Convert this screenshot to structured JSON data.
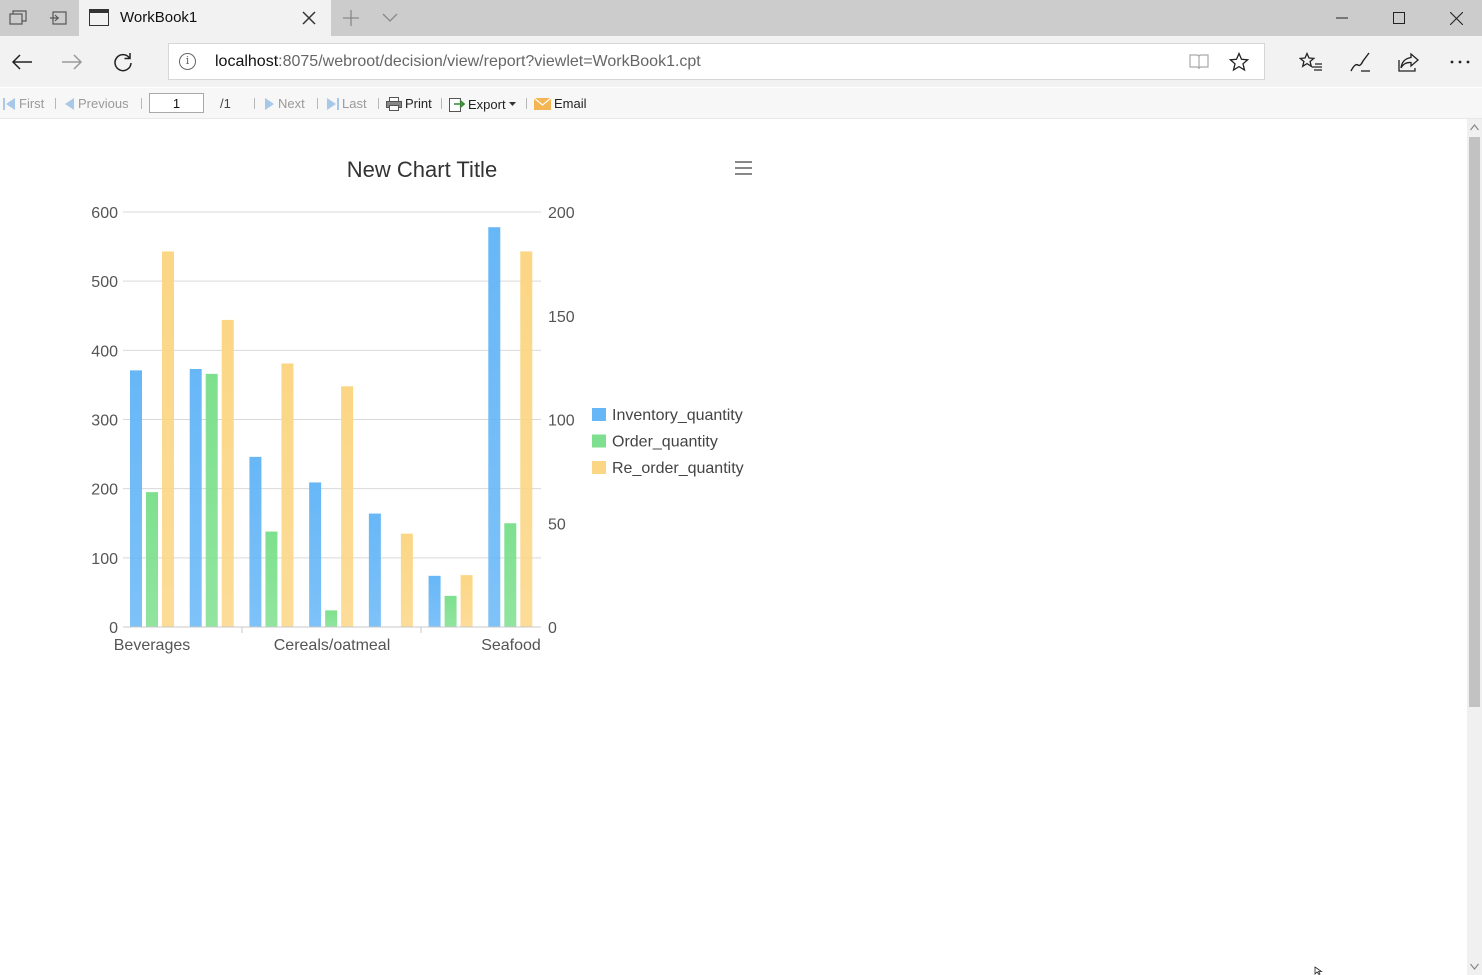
{
  "browser": {
    "tab_title": "WorkBook1",
    "address_host": "localhost",
    "address_rest": ":8075/webroot/decision/view/report?viewlet=WorkBook1.cpt"
  },
  "toolbar": {
    "first": "First",
    "previous": "Previous",
    "page_value": "1",
    "page_total": "/1",
    "next": "Next",
    "last": "Last",
    "print": "Print",
    "export": "Export",
    "email": "Email"
  },
  "chart_data": {
    "type": "bar",
    "title": "New Chart Title",
    "categories": [
      "Beverages",
      "",
      "Cereals/oatmeal",
      "",
      "",
      "",
      "Seafood"
    ],
    "x_tick_labels": [
      "Beverages",
      "Cereals/oatmeal",
      "Seafood"
    ],
    "left_axis": {
      "ylim": [
        0,
        600
      ],
      "ticks": [
        "0",
        "100",
        "200",
        "300",
        "400",
        "500",
        "600"
      ]
    },
    "right_axis": {
      "ylim": [
        0,
        200
      ],
      "ticks": [
        "0",
        "50",
        "100",
        "150",
        "200"
      ]
    },
    "grid": true,
    "legend_position": "right",
    "series": [
      {
        "name": "Inventory_quantity",
        "axis": "left",
        "color": "#67b7f7",
        "values": [
          371,
          373,
          246,
          209,
          164,
          74,
          578
        ]
      },
      {
        "name": "Order_quantity",
        "axis": "right",
        "color": "#7ee08e",
        "values": [
          65,
          122,
          46,
          8,
          0,
          15,
          50
        ]
      },
      {
        "name": "Re_order_quantity",
        "axis": "right",
        "color": "#fbd685",
        "values": [
          181,
          148,
          127,
          116,
          45,
          25,
          181
        ]
      }
    ]
  }
}
